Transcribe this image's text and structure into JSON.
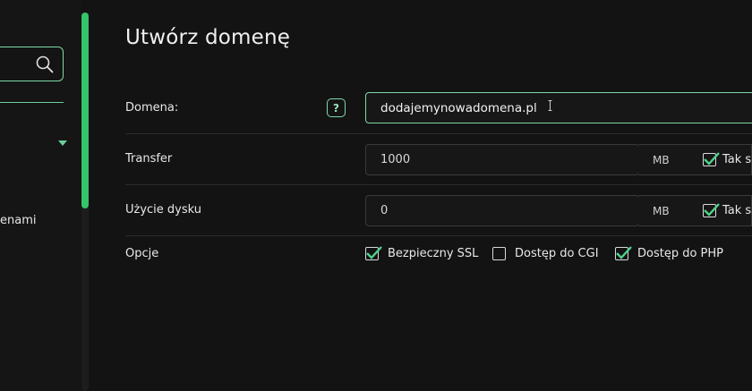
{
  "sidebar": {
    "search_placeholder": "",
    "item_label": "enami"
  },
  "page": {
    "title": "Utwórz domenę"
  },
  "form": {
    "domain": {
      "label": "Domena:",
      "help_label": "?",
      "value": "dodajemynowadomena.pl"
    },
    "transfer": {
      "label": "Transfer",
      "value": "1000",
      "unit": "MB",
      "checkbox_label": "Tak s",
      "checked": true
    },
    "disk": {
      "label": "Użycie dysku",
      "value": "0",
      "unit": "MB",
      "checkbox_label": "Tak s",
      "checked": true
    },
    "options": {
      "label": "Opcje",
      "items": [
        {
          "label": "Bezpieczny SSL",
          "checked": true
        },
        {
          "label": "Dostęp do CGI",
          "checked": false
        },
        {
          "label": "Dostęp do PHP",
          "checked": true
        }
      ]
    }
  },
  "colors": {
    "accent": "#34c46a",
    "accent_border": "#7fd9a6",
    "check": "#4fd38a",
    "background": "#131313"
  }
}
